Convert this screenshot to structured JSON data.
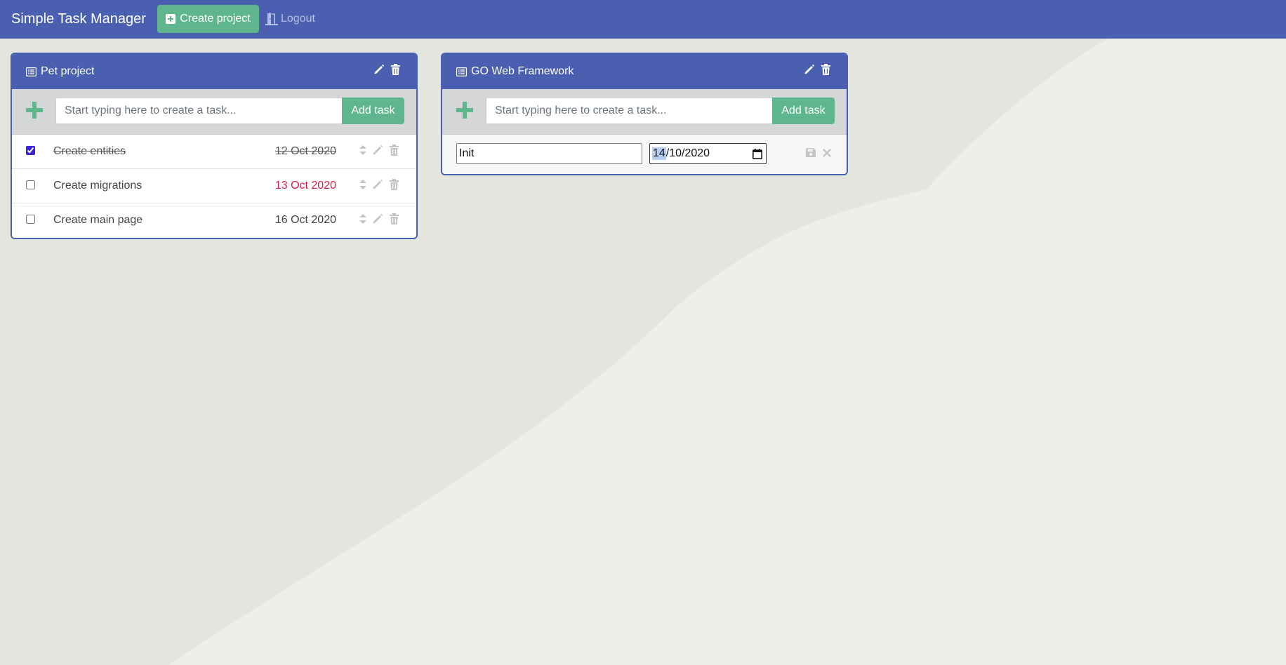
{
  "navbar": {
    "brand": "Simple Task Manager",
    "create_label": "Create project",
    "logout_label": "Logout"
  },
  "colors": {
    "primary": "#4a5fb0",
    "success": "#5fb58c",
    "overdue": "#e31949"
  },
  "projects": [
    {
      "title": "Pet project",
      "add_placeholder": "Start typing here to create a task...",
      "add_button": "Add task",
      "tasks": [
        {
          "name": "Create entities",
          "date": "12 Oct 2020",
          "done": true,
          "overdue": false
        },
        {
          "name": "Create migrations",
          "date": "13 Oct 2020",
          "done": false,
          "overdue": true
        },
        {
          "name": "Create main page",
          "date": "16 Oct 2020",
          "done": false,
          "overdue": false
        }
      ]
    },
    {
      "title": "GO Web Framework",
      "add_placeholder": "Start typing here to create a task...",
      "add_button": "Add task",
      "editing_task": {
        "name": "Init",
        "date_day": "14",
        "date_rest": "/10/2020"
      }
    }
  ]
}
